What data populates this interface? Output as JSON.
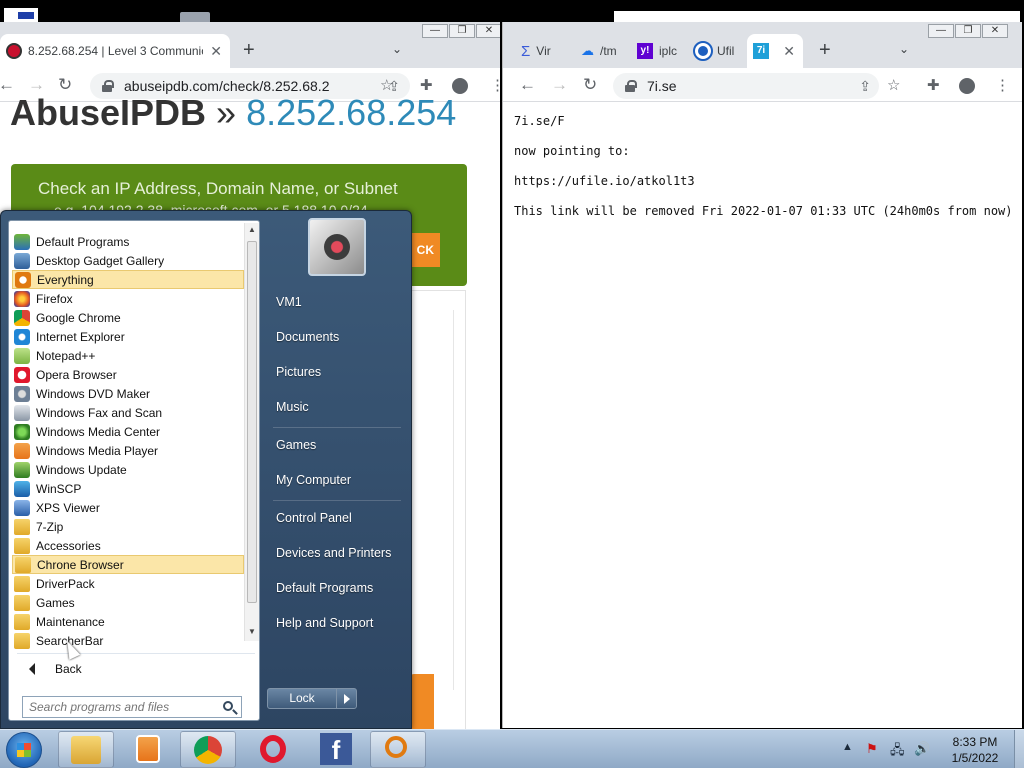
{
  "left_browser": {
    "tab_title": "8.252.68.254 | Level 3 Communic",
    "url": "abuseipdb.com/check/8.252.68.2",
    "page": {
      "site_title": "AbuseIPDB",
      "separator": "»",
      "ip": "8.252.68.254",
      "check_title": "Check an IP Address, Domain Name, or Subnet",
      "example_text": "e.g. 104.192.2.38, microsoft.com, or 5.188.10.0/24",
      "check_button": "CK"
    }
  },
  "right_browser": {
    "tabs": [
      {
        "title": "Vir",
        "icon": "virustotal-icon"
      },
      {
        "title": "/tm",
        "icon": "cloud-upload-icon"
      },
      {
        "title": "iplc",
        "icon": "yahoo-icon"
      },
      {
        "title": "Ufil",
        "icon": "ufile-icon"
      },
      {
        "title": "7i",
        "icon": "7i-icon",
        "active": true
      }
    ],
    "url": "7i.se",
    "page": {
      "line1": "7i.se/F",
      "line2": "now pointing to:",
      "line3": "https://ufile.io/atkol1t3",
      "line4": "This link will be removed Fri 2022-01-07 01:33 UTC (24h0m0s from now)"
    }
  },
  "start_menu": {
    "programs": [
      {
        "label": "Default Programs",
        "icon": "default-programs-icon"
      },
      {
        "label": "Desktop Gadget Gallery",
        "icon": "gadget-icon"
      },
      {
        "label": "Everything",
        "icon": "everything-icon",
        "highlighted": true
      },
      {
        "label": "Firefox",
        "icon": "firefox-icon"
      },
      {
        "label": "Google Chrome",
        "icon": "chrome-icon"
      },
      {
        "label": "Internet Explorer",
        "icon": "ie-icon"
      },
      {
        "label": "Notepad++",
        "icon": "notepadpp-icon"
      },
      {
        "label": "Opera Browser",
        "icon": "opera-icon"
      },
      {
        "label": "Windows DVD Maker",
        "icon": "dvd-maker-icon"
      },
      {
        "label": "Windows Fax and Scan",
        "icon": "fax-icon"
      },
      {
        "label": "Windows Media Center",
        "icon": "media-center-icon"
      },
      {
        "label": "Windows Media Player",
        "icon": "media-player-icon"
      },
      {
        "label": "Windows Update",
        "icon": "windows-update-icon"
      },
      {
        "label": "WinSCP",
        "icon": "winscp-icon"
      },
      {
        "label": "XPS Viewer",
        "icon": "xps-icon"
      },
      {
        "label": "7-Zip",
        "icon": "folder-icon"
      },
      {
        "label": "Accessories",
        "icon": "folder-icon"
      },
      {
        "label": "Chrone Browser",
        "icon": "folder-icon",
        "highlighted": true
      },
      {
        "label": "DriverPack",
        "icon": "folder-icon"
      },
      {
        "label": "Games",
        "icon": "folder-icon"
      },
      {
        "label": "Maintenance",
        "icon": "folder-icon"
      },
      {
        "label": "SearcherBar",
        "icon": "folder-icon"
      }
    ],
    "back_label": "Back",
    "search_placeholder": "Search programs and files",
    "right_links": {
      "user": "VM1",
      "documents": "Documents",
      "pictures": "Pictures",
      "music": "Music",
      "games": "Games",
      "computer": "My Computer",
      "control_panel": "Control Panel",
      "devices": "Devices and Printers",
      "default_programs": "Default Programs",
      "help": "Help and Support"
    },
    "lock_label": "Lock"
  },
  "taskbar": {
    "time": "8:33 PM",
    "date": "1/5/2022",
    "tray_arrow": "▲"
  },
  "colors": {
    "abuse_green": "#5a8b17",
    "abuse_orange": "#f08a24",
    "abuse_ip_blue": "#2e8ab8",
    "highlight": "#fbe6a8"
  }
}
